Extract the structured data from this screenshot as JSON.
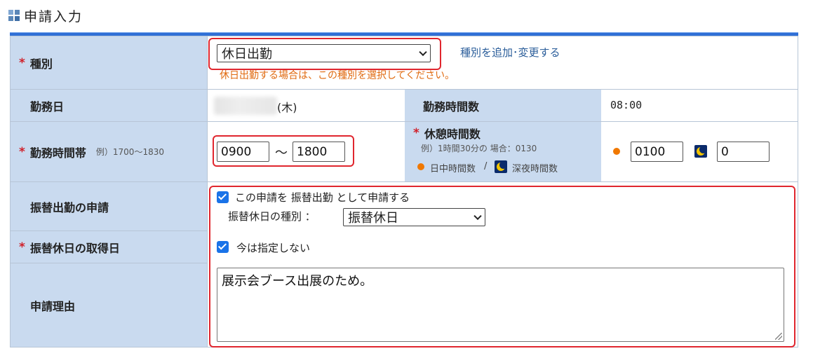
{
  "page": {
    "title": "申請入力"
  },
  "form": {
    "category": {
      "label": "種別",
      "selected": "休日出勤",
      "add_link": "種別を追加･変更する",
      "hint": "休日出勤する場合は、この種別を選択してください。"
    },
    "work_date": {
      "label": "勤務日",
      "weekday": "(木)"
    },
    "work_hours": {
      "label": "勤務時間数",
      "value": "08:00"
    },
    "work_time": {
      "label": "勤務時間帯",
      "example": "例）1700〜1830",
      "start": "0900",
      "separator": "〜",
      "end": "1800"
    },
    "break_time": {
      "label": "休憩時間数",
      "example": "例）1時間30分の 場合：0130",
      "day_legend": "日中時間数",
      "legend_sep": "/",
      "night_legend": "深夜時間数",
      "day_value": "0100",
      "night_value": "0"
    },
    "substitute_request": {
      "label": "振替出勤の申請",
      "checkbox_text": "この申請を 振替出勤 として申請する",
      "checked": true,
      "kind_label": "振替休日の種別 ：",
      "kind_selected": "振替休日"
    },
    "substitute_date": {
      "label": "振替休日の取得日",
      "checkbox_text": "今は指定しない",
      "checked": true
    },
    "reason": {
      "label": "申請理由",
      "value": "展示会ブース出展のため。"
    }
  },
  "icons": {
    "header": "grid-icon",
    "day": "sun-icon",
    "night": "moon-icon",
    "check": "checkbox-checked-icon"
  },
  "colors": {
    "label_bg": "#c9daef",
    "accent_bar": "#2f6fd6",
    "required": "#d0202a",
    "hint": "#e06a10",
    "highlight": "#e0262e",
    "link": "#2a5d9a"
  }
}
